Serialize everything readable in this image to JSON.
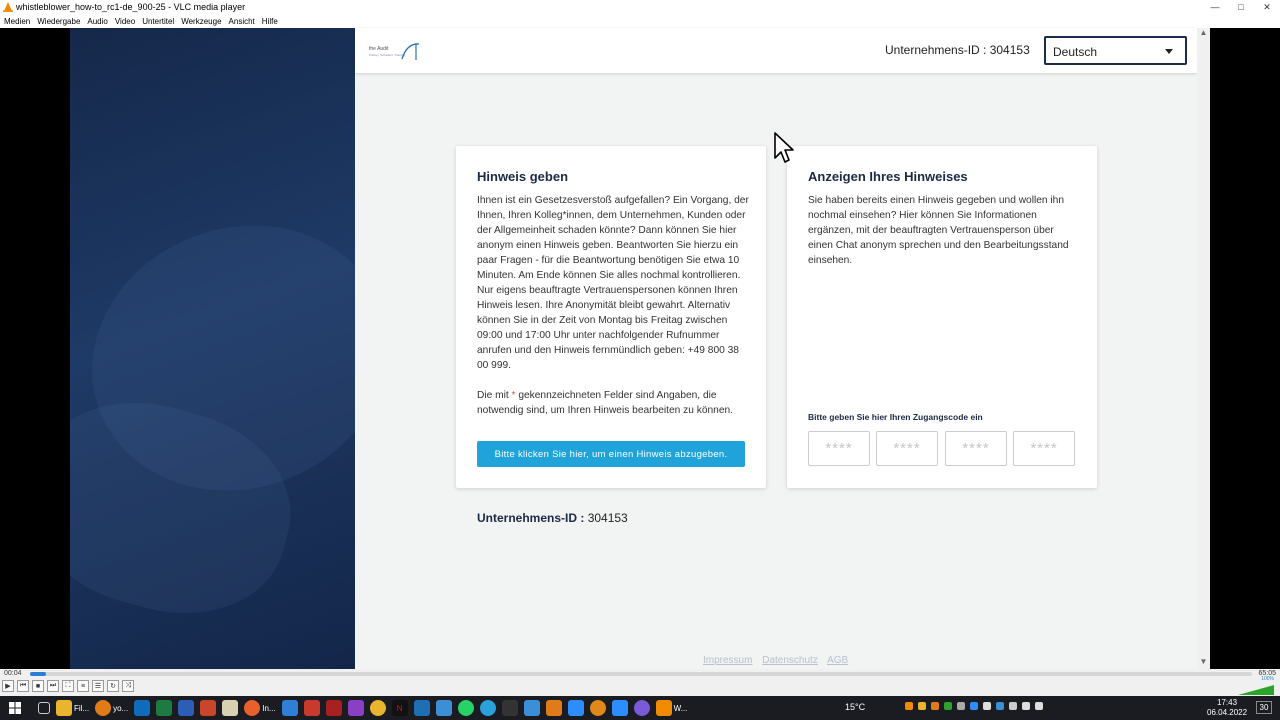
{
  "window": {
    "title": "whistleblower_how-to_rc1-de_900-25 - VLC media player",
    "buttons": {
      "minimize": "—",
      "maximize": "□",
      "close": "✕"
    }
  },
  "menubar": [
    "Medien",
    "Wiedergabe",
    "Audio",
    "Video",
    "Untertitel",
    "Werkzeuge",
    "Ansicht",
    "Hilfe"
  ],
  "app": {
    "logo_text": "the Audit",
    "logo_sub": "Polizey, Schadenz Training",
    "header_company_id": "Unternehmens-ID : 304153",
    "language": "Deutsch",
    "left_card": {
      "title": "Hinweis geben",
      "paragraph1": "Ihnen ist ein Gesetzesverstoß aufgefallen? Ein Vorgang, der Ihnen, Ihren Kolleg*innen, dem Unternehmen, Kunden oder der Allgemeinheit schaden könnte? Dann können Sie hier anonym einen Hinweis geben. Beantworten Sie hierzu ein paar Fragen - für die Beantwortung benötigen Sie etwa 10 Minuten. Am Ende können Sie alles nochmal kontrollieren. Nur eigens beauftragte Vertrauenspersonen können Ihren Hinweis lesen. Ihre Anonymität bleibt gewahrt. Alternativ können Sie in der Zeit von Montag bis Freitag zwischen 09:00 und 17:00 Uhr unter nachfolgender Rufnummer anrufen und den Hinweis fernmündlich geben: +49 800 38 00 999.",
      "paragraph2_pre": "Die mit ",
      "paragraph2_star": "*",
      "paragraph2_post": " gekennzeichneten Felder sind Angaben, die notwendig sind, um Ihren Hinweis bearbeiten zu können.",
      "button": "Bitte klicken Sie hier, um einen Hinweis abzugeben."
    },
    "right_card": {
      "title": "Anzeigen Ihres Hinweises",
      "paragraph": "Sie haben bereits einen Hinweis gegeben und wollen ihn nochmal einsehen? Hier können Sie Informationen ergänzen, mit der beauftragten Vertrauensperson über einen Chat anonym sprechen und den Bearbeitungsstand einsehen.",
      "code_label": "Bitte geben Sie hier Ihren Zugangscode ein",
      "code_placeholders": [
        "****",
        "****",
        "****",
        "****"
      ]
    },
    "bottom_company_id_label": "Unternehmens-ID :",
    "bottom_company_id_value": "304153",
    "footer_links": [
      "Impressum",
      "Datenschutz",
      "AGB"
    ]
  },
  "player": {
    "time_elapsed": "00:04",
    "time_total": "65:05",
    "progress": 0.013,
    "volume_label": "100%"
  },
  "taskbar": {
    "apps": [
      {
        "label": "Fil..."
      },
      {
        "label": "yo..."
      },
      {
        "label": "In..."
      },
      {
        "label": "W..."
      }
    ],
    "weather": "15°C",
    "time": "17:43",
    "date": "06.04.2022",
    "notifications": "30"
  }
}
